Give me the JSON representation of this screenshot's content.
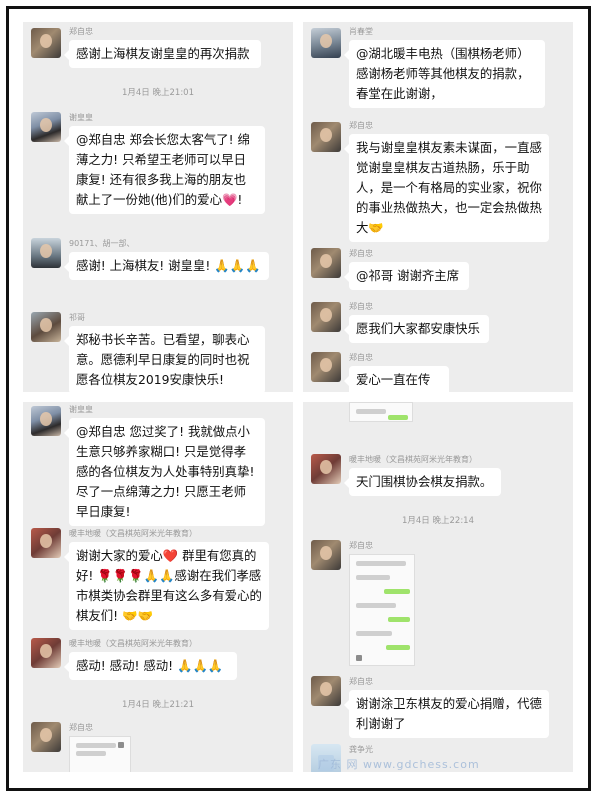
{
  "panel1": {
    "msg1": {
      "name": "郑自忠",
      "text": "感谢上海棋友谢皇皇的再次捐款"
    },
    "time1": "1月4日 晚上21:01",
    "msg2": {
      "name": "谢皇皇",
      "text": "@郑自忠  郑会长您太客气了! 绵薄之力! 只希望王老师可以早日康复! 还有很多我上海的朋友也献上了一份她(他)们的爱心💗!"
    },
    "msg3": {
      "name": "90171、胡一部、",
      "text": "感谢! 上海棋友! 谢皇皇! 🙏🙏🙏"
    },
    "msg4": {
      "name": "祁哥",
      "text": "郑秘书长辛苦。已看望，聊表心意。愿德利早日康复的同时也祝愿各位棋友2019安康快乐!"
    }
  },
  "panel2": {
    "msg1": {
      "name": "肖春堂",
      "text": "@湖北暖丰电热（围棋杨老师）感谢杨老师等其他棋友的捐款，春堂在此谢谢，"
    },
    "msg2": {
      "name": "郑自忠",
      "text": "我与谢皇皇棋友素未谋面，一直感觉谢皇皇棋友古道热肠，乐于助人，是一个有格局的实业家，祝你的事业热做热大，也一定会热做热大🤝"
    },
    "msg3": {
      "name": "郑自忠",
      "text": "@祁哥  谢谢齐主席"
    },
    "msg4": {
      "name": "郑自忠",
      "text": "愿我们大家都安康快乐"
    },
    "msg5": {
      "name": "郑自忠",
      "text": "爱心一直在传递"
    }
  },
  "panel3": {
    "msg1": {
      "name": "谢皇皇",
      "text": "@郑自忠  您过奖了! 我就做点小生意只够养家糊口! 只是觉得孝感的各位棋友为人处事特别真挚! 尽了一点绵薄之力! 只愿王老师早日康复!"
    },
    "msg2": {
      "name": "暖丰地暖（文昌棋苑阿米光年教育）",
      "text": "谢谢大家的爱心❤️ 群里有您真的好! 🌹🌹🌹🙏🙏感谢在我们孝感市棋类协会群里有这么多有爱心的棋友们! 🤝🤝"
    },
    "msg3": {
      "name": "暖丰地暖（文昌棋苑阿米光年教育）",
      "text": "感动! 感动! 感动! 🙏🙏🙏"
    },
    "time1": "1月4日 晚上21:21",
    "msg4": {
      "name": "郑自忠"
    }
  },
  "panel4": {
    "msg1": {
      "name": "暖丰地暖（文昌棋苑阿米光年教育）",
      "text": "天门围棋协会棋友捐款。"
    },
    "time1": "1月4日 晚上22:14",
    "msg2": {
      "name": "郑自忠"
    },
    "msg3": {
      "name": "郑自忠",
      "text": "谢谢涂卫东棋友的爱心捐赠，代德利谢谢了"
    },
    "msg4": {
      "name": "龚争光"
    }
  },
  "watermark": "广东    网  www.gdchess.com",
  "colors": {
    "panel_bg": "#ededed",
    "bubble_bg": "#ffffff",
    "frame": "#111111",
    "meta_text": "#999999"
  }
}
